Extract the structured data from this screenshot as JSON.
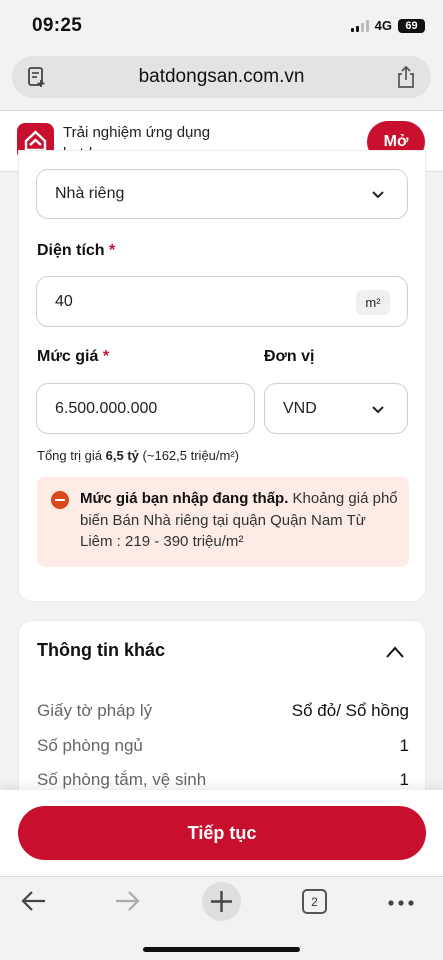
{
  "status": {
    "time": "09:25",
    "network": "4G",
    "battery": "69"
  },
  "browser": {
    "host": "batdongsan.com.vn",
    "tabs_count": "2"
  },
  "banner": {
    "line1": "Trải nghiệm ứng dụng",
    "line2": "batdongsan.com.vn",
    "open_label": "Mở"
  },
  "form": {
    "property_type_value": "Nhà riêng",
    "area_label": "Diện tích",
    "area_value": "40",
    "area_unit": "m²",
    "price_label": "Mức giá",
    "price_value": "6.500.000.000",
    "unit_label": "Đơn vị",
    "unit_value": "VND",
    "required_mark": "*",
    "total_prefix": "Tổng trị giá",
    "total_value": "6,5 tỷ",
    "total_suffix": "(~162,5 triệu/m²)",
    "warning_title": "Mức giá bạn nhập đang thấp.",
    "warning_text": "Khoảng giá phổ biến Bán Nhà riêng tại quận Quận Nam Từ Liêm : 219 - 390 triệu/m²"
  },
  "other_info": {
    "title": "Thông tin khác",
    "rows": [
      {
        "key": "Giấy tờ pháp lý",
        "value": "Sổ đỏ/ Sổ hồng"
      },
      {
        "key": "Số phòng ngủ",
        "value": "1"
      },
      {
        "key": "Số phòng tắm, vệ sinh",
        "value": "1"
      }
    ]
  },
  "action": {
    "continue_label": "Tiếp tục"
  },
  "colors": {
    "brand_red": "#c8102e",
    "warning_bg": "#fdebe6",
    "warning_icon": "#d94a1a"
  }
}
